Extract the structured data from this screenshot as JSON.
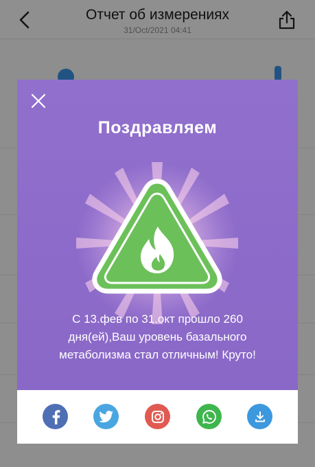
{
  "nav": {
    "title": "Отчет об измерениях",
    "subtitle": "31/Oct/2021 04:41",
    "back_icon": "chevron-left-icon",
    "share_icon": "share-icon"
  },
  "modal": {
    "close_icon": "close-icon",
    "heading": "Поздравляем",
    "emblem_icon": "flame-warning-icon",
    "message": "С 13.фев по 31.окт прошло 260 дня(ей),Ваш уровень базального метаболизма стал отличным! Круто!",
    "share_buttons": [
      {
        "name": "facebook",
        "icon": "facebook-icon",
        "color": "#4f6fb4"
      },
      {
        "name": "twitter",
        "icon": "twitter-icon",
        "color": "#4aa6e0"
      },
      {
        "name": "instagram",
        "icon": "instagram-icon",
        "color": "#e05a52"
      },
      {
        "name": "whatsapp",
        "icon": "whatsapp-icon",
        "color": "#3fb64d"
      },
      {
        "name": "download",
        "icon": "download-icon",
        "color": "#3d98de"
      }
    ]
  },
  "colors": {
    "modal_purple": "#8d6bca",
    "emblem_green": "#6cc05a",
    "overlay": "rgba(0,0,0,0.42)"
  }
}
